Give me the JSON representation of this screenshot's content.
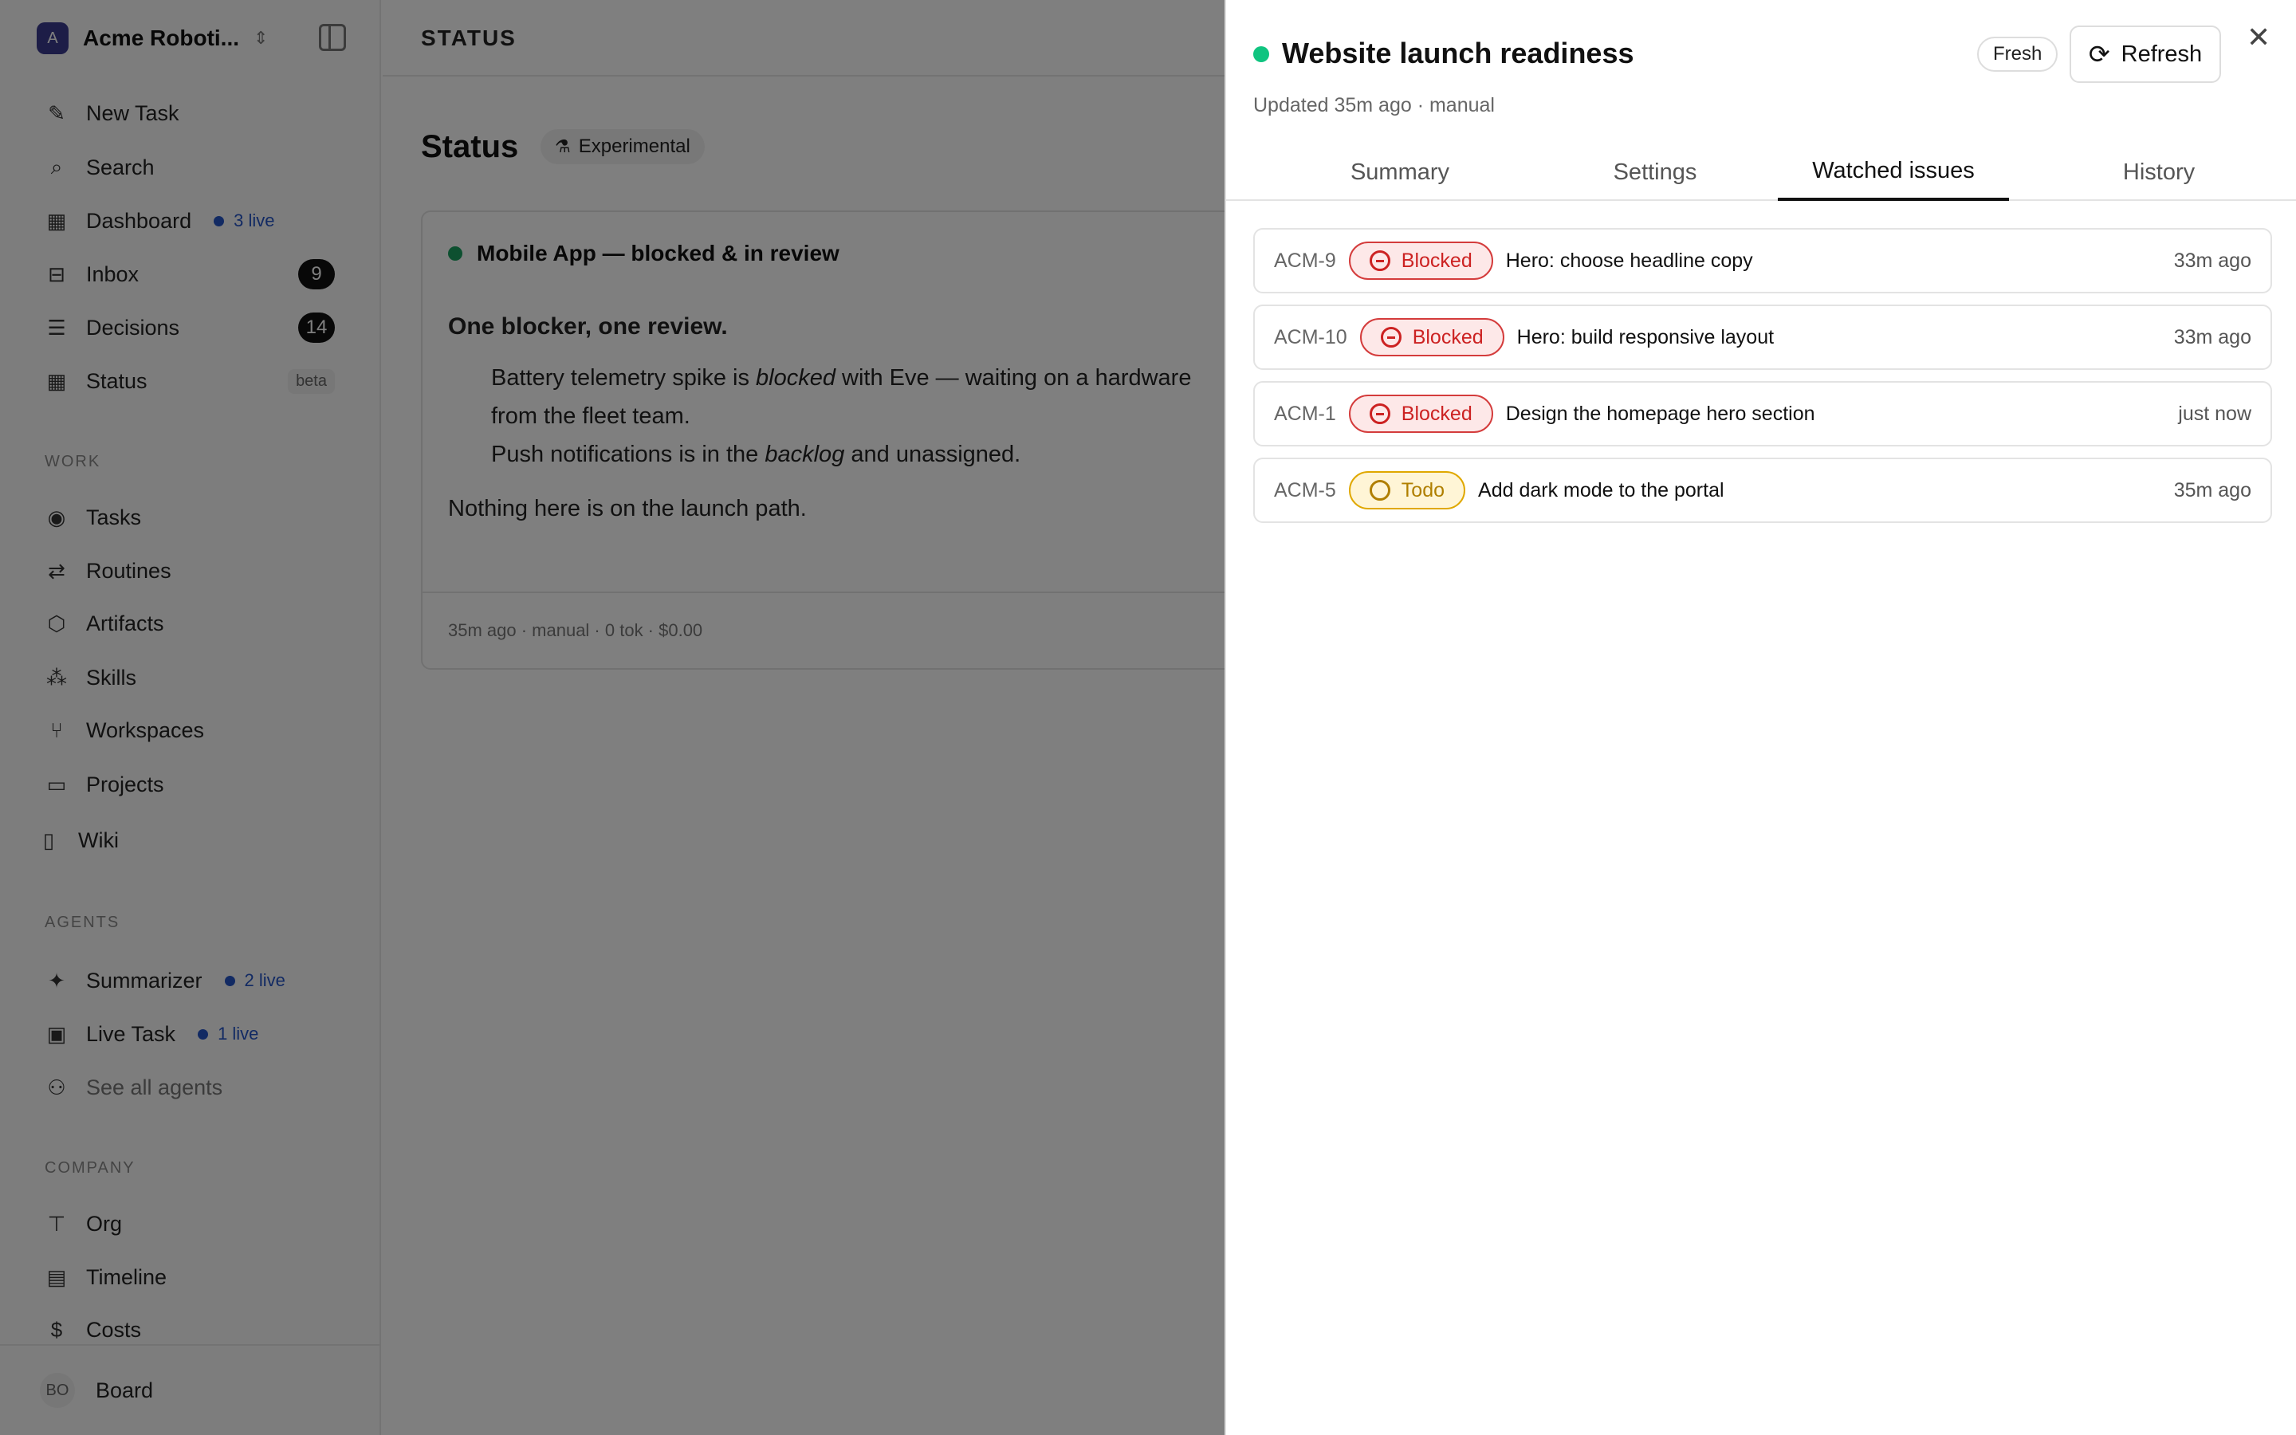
{
  "sidebar": {
    "workspace": {
      "initial": "A",
      "name": "Acme Roboti..."
    },
    "nav": [
      {
        "label": "New Task",
        "icon": "edit-icon"
      },
      {
        "label": "Search",
        "icon": "search-icon"
      },
      {
        "label": "Dashboard",
        "icon": "dashboard-icon",
        "live": "3 live"
      },
      {
        "label": "Inbox",
        "icon": "inbox-icon",
        "badge": "9"
      },
      {
        "label": "Decisions",
        "icon": "checklist-icon",
        "badge": "14"
      },
      {
        "label": "Status",
        "icon": "grid-icon",
        "tag": "beta"
      }
    ],
    "work_heading": "WORK",
    "work": [
      {
        "label": "Tasks",
        "icon": "circle-dot-icon"
      },
      {
        "label": "Routines",
        "icon": "repeat-icon"
      },
      {
        "label": "Artifacts",
        "icon": "box-icon"
      },
      {
        "label": "Skills",
        "icon": "boxes-icon"
      },
      {
        "label": "Workspaces",
        "icon": "git-branch-icon"
      },
      {
        "label": "Projects",
        "icon": "folder-icon"
      },
      {
        "label": "Wiki",
        "icon": "book-icon"
      }
    ],
    "agents_heading": "AGENTS",
    "agents": [
      {
        "label": "Summarizer",
        "icon": "sparkles-icon",
        "live": "2 live"
      },
      {
        "label": "Live Task",
        "icon": "cpu-icon",
        "live": "1 live"
      },
      {
        "label": "See all agents",
        "icon": "users-icon"
      }
    ],
    "company_heading": "COMPANY",
    "company": [
      {
        "label": "Org",
        "icon": "org-icon"
      },
      {
        "label": "Timeline",
        "icon": "list-icon"
      },
      {
        "label": "Costs",
        "icon": "dollar-icon"
      }
    ],
    "footer": {
      "initials": "BO",
      "label": "Board"
    }
  },
  "main": {
    "breadcrumb": "STATUS",
    "title": "Status",
    "experimental": "Experimental",
    "card": {
      "header": "Mobile App — blocked & in review",
      "heading": "One blocker, one review.",
      "bullet1_a": "Battery telemetry spike is ",
      "bullet1_em": "blocked",
      "bullet1_b": " with Eve — waiting on a hardware",
      "bullet1_line2": "from the fleet team.",
      "bullet2_a": "Push notifications is in the ",
      "bullet2_em": "backlog",
      "bullet2_b": " and unassigned.",
      "closing": "Nothing here is on the launch path.",
      "footer": "35m ago · manual · 0 tok · $0.00"
    }
  },
  "drawer": {
    "title": "Website launch readiness",
    "subtitle": "Updated 35m ago · manual",
    "fresh": "Fresh",
    "refresh": "Refresh",
    "tabs": [
      "Summary",
      "Settings",
      "Watched issues",
      "History"
    ],
    "active_tab": "Watched issues",
    "issues": [
      {
        "id": "ACM-9",
        "status": "Blocked",
        "title": "Hero: choose headline copy",
        "time": "33m ago"
      },
      {
        "id": "ACM-10",
        "status": "Blocked",
        "title": "Hero: build responsive layout",
        "time": "33m ago"
      },
      {
        "id": "ACM-1",
        "status": "Blocked",
        "title": "Design the homepage hero section",
        "time": "just now"
      },
      {
        "id": "ACM-5",
        "status": "Todo",
        "title": "Add dark mode to the portal",
        "time": "35m ago"
      }
    ]
  },
  "colors": {
    "live_blue": "#2554c7",
    "green_dot": "#10c480",
    "blocked_red": "#d43c3c",
    "todo_amber": "#e0a800"
  }
}
